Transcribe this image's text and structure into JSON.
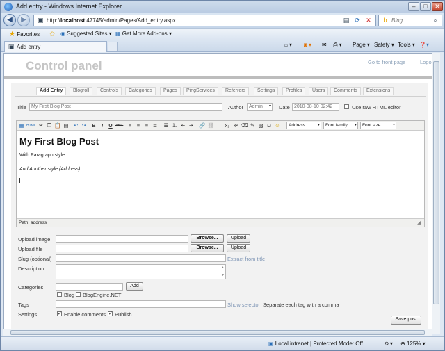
{
  "window": {
    "title": "Add entry - Windows Internet Explorer"
  },
  "browser": {
    "url_prefix": "http://",
    "url_host": "localhost",
    "url_rest": ":47745/admin/Pages/Add_entry.aspx",
    "search_placeholder": "Bing",
    "favorites_label": "Favorites",
    "suggested_sites": "Suggested Sites ▾",
    "get_addons": "Get More Add-ons ▾",
    "tab_label": "Add entry",
    "cmd_page": "Page ▾",
    "cmd_safety": "Safety ▾",
    "cmd_tools": "Tools ▾"
  },
  "header": {
    "title": "Control panel",
    "front_link": "Go to front page",
    "logoff": "Logo"
  },
  "tabs": [
    "Add Entry",
    "Blogroll",
    "Controls",
    "Categories",
    "Pages",
    "PingServices",
    "Referrers",
    "Settings",
    "Profiles",
    "Users",
    "Comments",
    "Extensions"
  ],
  "form": {
    "title_label": "Title",
    "title_value": "My First Blog Post",
    "author_label": "Author",
    "author_value": "Admin",
    "date_label": "Date",
    "date_value": "2010-08-10 02:42",
    "raw_html_label": "Use raw HTML editor"
  },
  "editor": {
    "format_select": "Address",
    "font_family": "Font family",
    "font_size": "Font size",
    "heading": "My First Blog Post",
    "para1": "With Paragraph style",
    "para2": "And Another style (Address)",
    "path": "Path: address"
  },
  "fields": {
    "upload_image_label": "Upload image",
    "upload_file_label": "Upload file",
    "browse": "Browse...",
    "upload": "Upload",
    "slug_label": "Slug (optional)",
    "extract_link": "Extract from title",
    "description_label": "Description",
    "categories_label": "Categories",
    "add": "Add",
    "cat_blog": "Blog",
    "cat_be": "BlogEngine.NET",
    "tags_label": "Tags",
    "show_selector": "Show selector",
    "tags_hint": "Separate each tag with a comma",
    "settings_label": "Settings",
    "enable_comments": "Enable comments",
    "publish": "Publish",
    "save_post": "Save post"
  },
  "status": {
    "zone": "Local intranet | Protected Mode: Off",
    "zoom": "125%"
  }
}
